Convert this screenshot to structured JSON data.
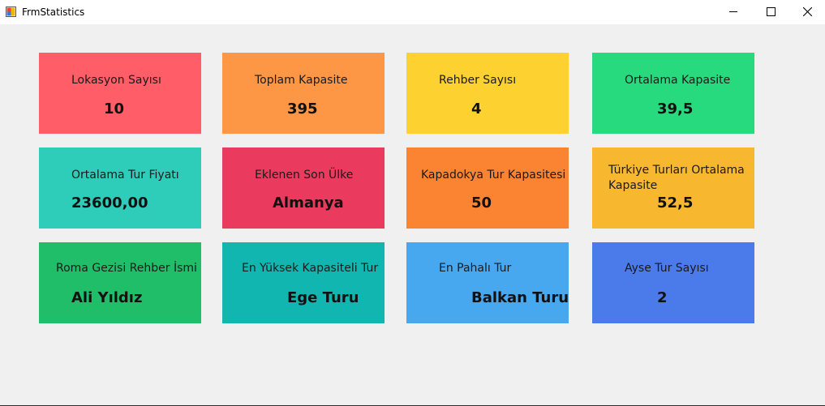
{
  "window": {
    "title": "FrmStatistics",
    "app_icon": "windows-form-icon",
    "controls": {
      "minimize_icon": "minimize-icon",
      "maximize_icon": "maximize-icon",
      "close_icon": "close-icon"
    }
  },
  "cards": [
    {
      "label": "Lokasyon Sayısı",
      "value": "10",
      "color": "#ff5e68"
    },
    {
      "label": "Toplam Kapasite",
      "value": "395",
      "color": "#fd9645"
    },
    {
      "label": "Rehber Sayısı",
      "value": "4",
      "color": "#fdd230"
    },
    {
      "label": "Ortalama Kapasite",
      "value": "39,5",
      "color": "#27da7e"
    },
    {
      "label": "Ortalama Tur Fiyatı",
      "value": "23600,00",
      "color": "#2dcdb9"
    },
    {
      "label": "Eklenen Son Ülke",
      "value": "Almanya",
      "color": "#ea3a5e"
    },
    {
      "label": "Kapadokya Tur Kapasitesi",
      "value": "50",
      "color": "#fb8433"
    },
    {
      "label": "Türkiye Turları Ortalama Kapasite",
      "value": "52,5",
      "color": "#f7b72f"
    },
    {
      "label": "Roma Gezisi Rehber İsmi",
      "value": "Ali Yıldız",
      "color": "#20be68"
    },
    {
      "label": "En Yüksek Kapasiteli Tur",
      "value": "Ege Turu",
      "color": "#11b6b0"
    },
    {
      "label": "En Pahalı Tur",
      "value": "Balkan Turu",
      "color": "#47a8ef"
    },
    {
      "label": "Ayse Tur Sayısı",
      "value": "2",
      "color": "#4b7beb"
    }
  ]
}
